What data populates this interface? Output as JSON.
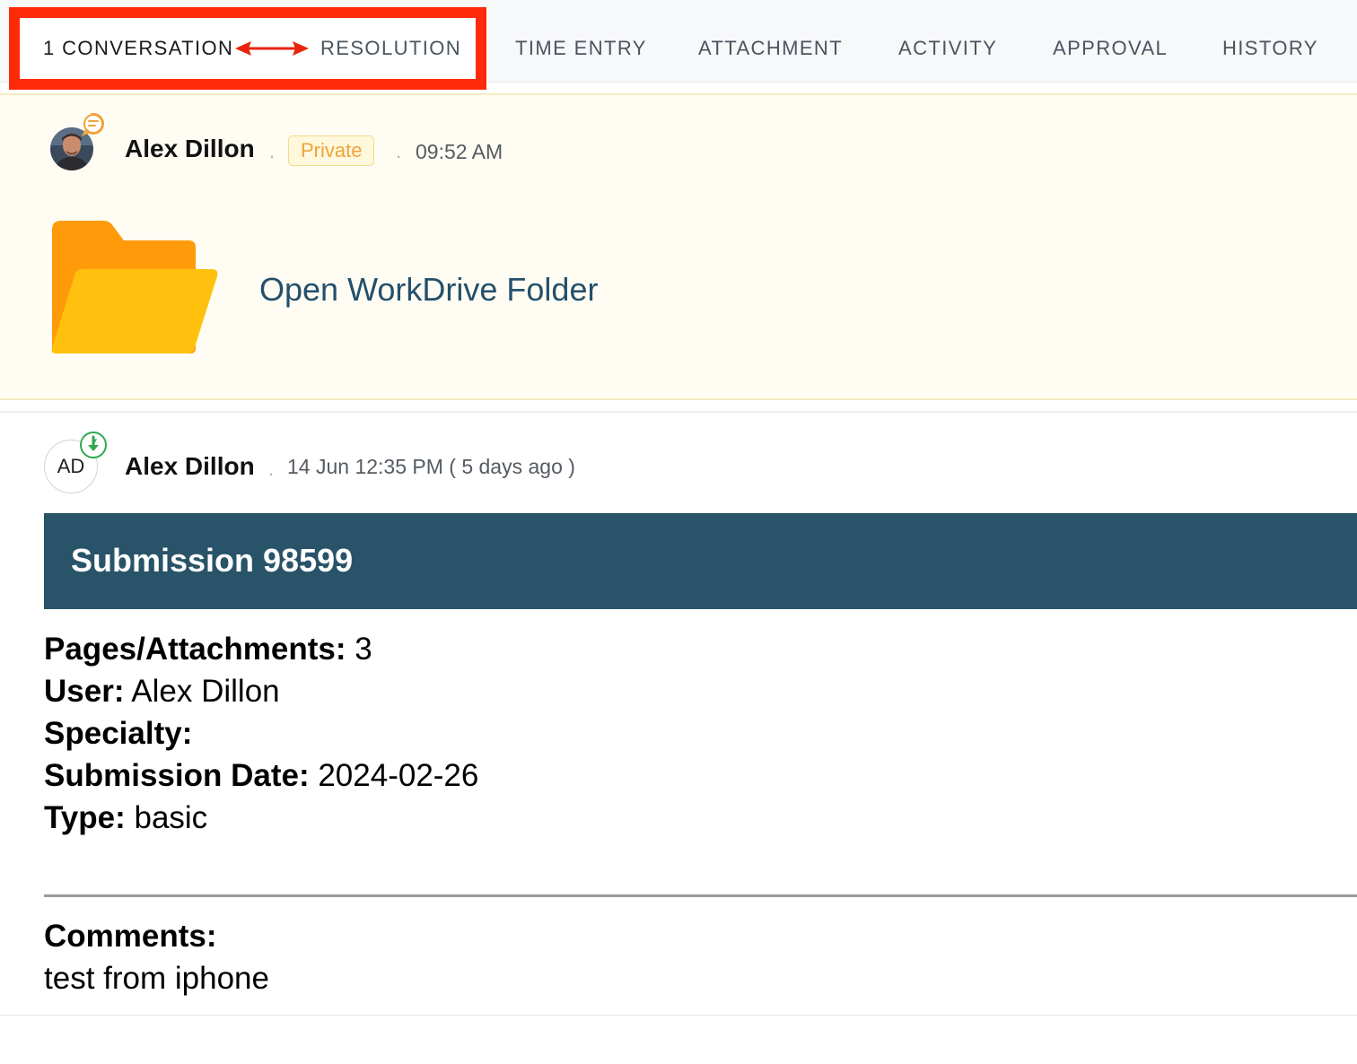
{
  "tabs": [
    {
      "label": "1 CONVERSATION",
      "active": true
    },
    {
      "label": "RESOLUTION"
    },
    {
      "label": "TIME ENTRY"
    },
    {
      "label": "ATTACHMENT"
    },
    {
      "label": "ACTIVITY"
    },
    {
      "label": "APPROVAL"
    },
    {
      "label": "HISTORY"
    }
  ],
  "annotation": {
    "color": "#ff2a0a",
    "arrow": "double-headed-arrow"
  },
  "private_note": {
    "author": "Alex Dillon",
    "separator": ".",
    "badge": "Private",
    "time": "09:52 AM",
    "avatar_icon": "user-photo-avatar",
    "badge_icon": "chat-bubble-icon",
    "folder_icon": "folder-icon",
    "link_text": "Open WorkDrive Folder",
    "background": "#fffdf3"
  },
  "email": {
    "avatar_initials": "AD",
    "channel_icon": "email-channel-icon",
    "author": "Alex Dillon",
    "separator": ".",
    "time": "14 Jun 12:35 PM ( 5 days ago )",
    "banner_title": "Submission 98599",
    "banner_color": "#285368",
    "fields": [
      {
        "label": "Pages/Attachments:",
        "value": " 3"
      },
      {
        "label": "User:",
        "value": " Alex Dillon"
      },
      {
        "label": "Specialty:",
        "value": ""
      },
      {
        "label": "Submission Date:",
        "value": " 2024-02-26"
      },
      {
        "label": "Type:",
        "value": " basic"
      }
    ],
    "comments_label": "Comments:",
    "comments_text": "test from iphone"
  }
}
